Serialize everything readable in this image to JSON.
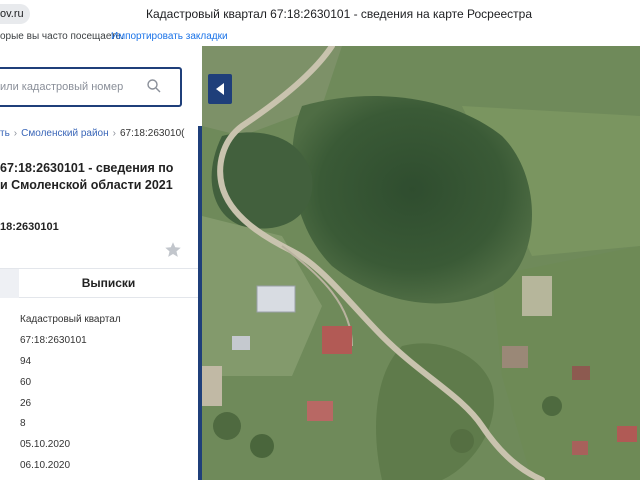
{
  "browser": {
    "url_fragment": "ov.ru",
    "window_title": "Кадастровый квартал 67:18:2630101 - сведения на карте Росреестра",
    "bookmarks_text": "орые вы часто посещаете.",
    "import_bookmarks": "Импортировать закладки"
  },
  "search": {
    "placeholder": "или кадастровый номер"
  },
  "breadcrumb": {
    "item1": "ть",
    "item2": "Смоленский район",
    "current": "67:18:263010("
  },
  "title": {
    "line1": "67:18:2630101 - сведения по",
    "line2": "и Смоленской области 2021"
  },
  "cadastral_number": "18:2630101",
  "tabs": {
    "extracts": "Выписки"
  },
  "info": {
    "type": "Кадастровый квартал",
    "number": "67:18:2630101",
    "value1": "94",
    "value2": "60",
    "value3": "26",
    "value4": "8",
    "date1": "05.10.2020",
    "date2": "06.10.2020"
  },
  "icons": {
    "search": "search-icon",
    "star": "star-icon",
    "collapse": "chevron-left-icon"
  },
  "colors": {
    "accent": "#1f3f7a",
    "link": "#3a66b8"
  }
}
